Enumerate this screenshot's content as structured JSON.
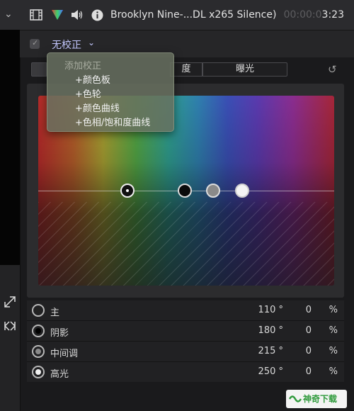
{
  "header": {
    "icons": [
      "film-strip-icon",
      "color-triangle-icon",
      "speaker-icon",
      "info-icon"
    ],
    "title": "Brooklyn Nine-...DL x265 Silence)",
    "timecode_dim": "00:00:0",
    "timecode_bright": "3:23"
  },
  "correction": {
    "label": "无校正",
    "enabled": true
  },
  "menu": {
    "header": "添加校正",
    "items": [
      "+颜色板",
      "+色轮",
      "+颜色曲线",
      "+色相/饱和度曲线"
    ]
  },
  "tabs": {
    "items": [
      "主",
      "阴影",
      "中间调",
      "高光"
    ],
    "visible_partial": "主",
    "exposure": "曝光"
  },
  "pucks": [
    "master",
    "shadows",
    "midtones",
    "highlights"
  ],
  "rows": [
    {
      "label": "主",
      "hue": "110 °",
      "sat": "0",
      "unit": "%",
      "swatch": "#222"
    },
    {
      "label": "阴影",
      "hue": "180 °",
      "sat": "0",
      "unit": "%",
      "swatch": "#000"
    },
    {
      "label": "中间调",
      "hue": "215 °",
      "sat": "0",
      "unit": "%",
      "swatch": "#8a8a8a"
    },
    {
      "label": "高光",
      "hue": "250 °",
      "sat": "0",
      "unit": "%",
      "swatch": "#f0f0f0"
    }
  ],
  "watermark": {
    "text": "神奇下载"
  },
  "colors": {
    "accent": "#c4c8ff",
    "watermark_green": "#2f9a3c"
  }
}
